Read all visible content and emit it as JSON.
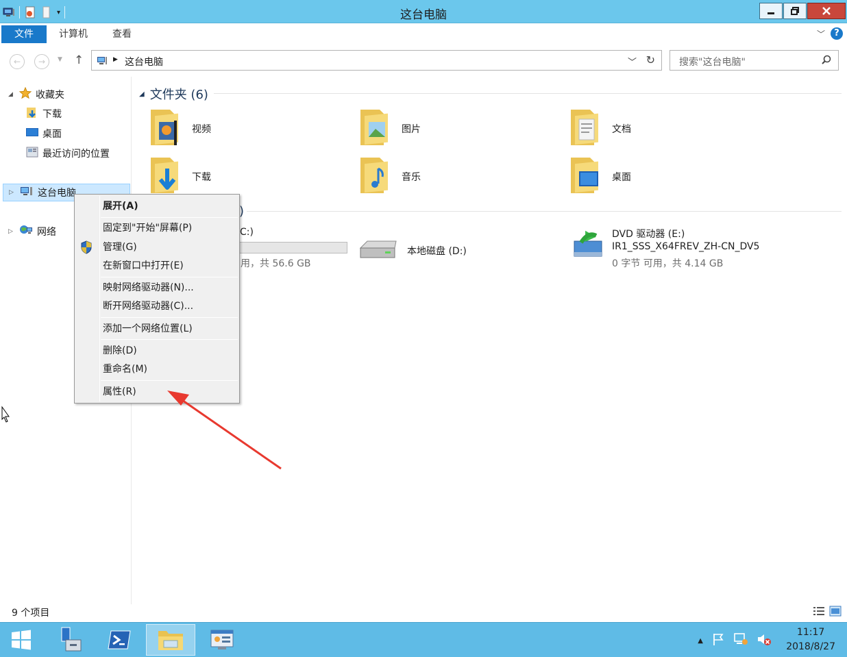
{
  "window": {
    "title": "这台电脑"
  },
  "ribbon": {
    "tabs": [
      "文件",
      "计算机",
      "查看"
    ]
  },
  "address": {
    "path": "这台电脑",
    "search_placeholder": "搜索\"这台电脑\""
  },
  "nav": {
    "favorites": "收藏夹",
    "downloads": "下载",
    "desktop": "桌面",
    "recent": "最近访问的位置",
    "this_pc": "这台电脑",
    "network": "网络"
  },
  "content": {
    "folders_group": "文件夹 (6)",
    "folders": [
      "视频",
      "图片",
      "文档",
      "下载",
      "音乐",
      "桌面"
    ],
    "devices_group_fragment": ")",
    "drive_c_fragment": "C:)",
    "drive_c_sub_fragment": "用，共 56.6 GB",
    "drive_d": "本地磁盘 (D:)",
    "drive_e_name": "DVD 驱动器 (E:)",
    "drive_e_label": "IR1_SSS_X64FREV_ZH-CN_DV5",
    "drive_e_sub": "0 字节 可用，共 4.14 GB"
  },
  "context_menu": {
    "items": [
      "展开(A)",
      "固定到\"开始\"屏幕(P)",
      "管理(G)",
      "在新窗口中打开(E)",
      "映射网络驱动器(N)...",
      "断开网络驱动器(C)...",
      "添加一个网络位置(L)",
      "删除(D)",
      "重命名(M)",
      "属性(R)"
    ]
  },
  "status": {
    "count": "9 个项目"
  },
  "taskbar": {
    "time": "11:17",
    "date": "2018/8/27"
  },
  "colors": {
    "titlebar": "#6bc7ec",
    "accent": "#1979ca",
    "taskbar": "#5fbbe6",
    "annotation_arrow": "#e8392f"
  }
}
